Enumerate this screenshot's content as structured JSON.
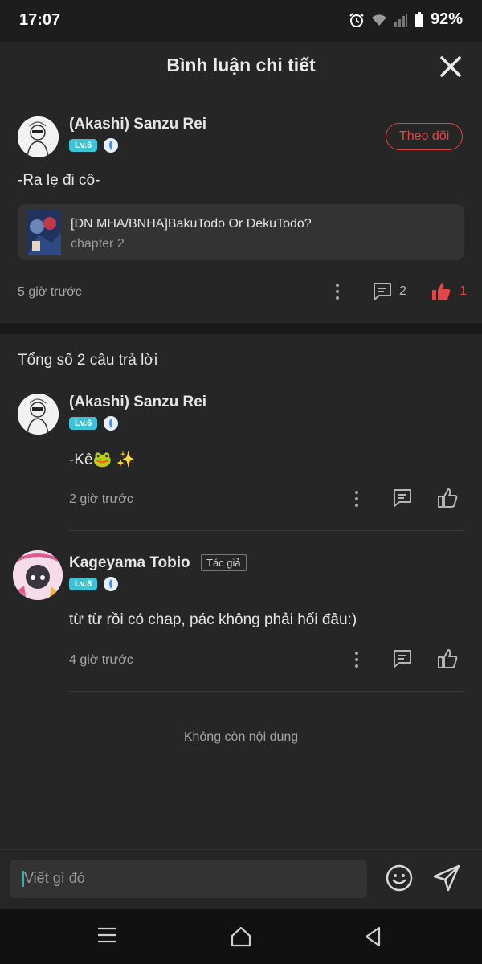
{
  "status_bar": {
    "time": "17:07",
    "battery": "92%"
  },
  "header": {
    "title": "Bình luận chi tiết"
  },
  "main_comment": {
    "username": "(Akashi) Sanzu Rei",
    "level": "Lv.6",
    "follow_label": "Theo dõi",
    "text": "-Ra lẹ đi cô-",
    "story": {
      "title": "[ĐN MHA/BNHA]BakuTodo Or DekuTodo?",
      "chapter": "chapter 2"
    },
    "time": "5 giờ trước",
    "reply_count": "2",
    "like_count": "1"
  },
  "replies_header": "Tổng số 2 câu trả lời",
  "replies": [
    {
      "username": "(Akashi) Sanzu Rei",
      "level": "Lv.6",
      "text": "-Kê🐸 ✨",
      "time": "2 giờ trước"
    },
    {
      "username": "Kageyama Tobio",
      "author_tag": "Tác giả",
      "level": "Lv.8",
      "text": "từ từ rồi có chap, pác không phải hối đâu:)",
      "time": "4 giờ trước"
    }
  ],
  "end_text": "Không còn nội dung",
  "composer": {
    "placeholder": "Viết gì đó"
  },
  "colors": {
    "accent_red": "#e24545",
    "level_badge": "#3cc4d6",
    "background": "#262626"
  }
}
